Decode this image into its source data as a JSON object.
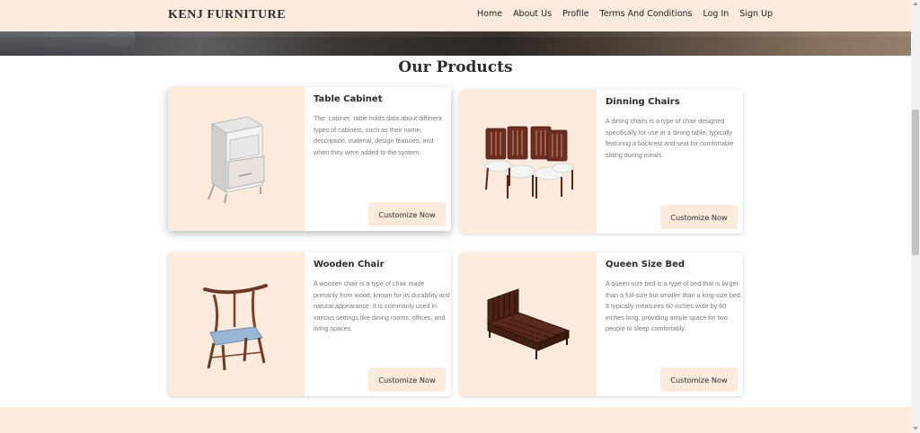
{
  "brand": "KENJ FURNITURE",
  "nav": [
    {
      "label": "Home"
    },
    {
      "label": "About Us"
    },
    {
      "label": "Profile"
    },
    {
      "label": "Terms And Conditions"
    },
    {
      "label": "Log In"
    },
    {
      "label": "Sign Up"
    }
  ],
  "section_title": "Our Products",
  "products": [
    {
      "title": "Table Cabinet",
      "description": "The `cabinet` table holds data about different types of cabinets, such as their name, description, material, design features, and when they were added to the system.",
      "button": "Customize Now",
      "image_icon": "cabinet-icon"
    },
    {
      "title": "Dinning Chairs",
      "description": "A dining chairs is a type of chair designed specifically for use at a dining table, typically featuring a backrest and seat for comfortable sitting during meals.",
      "button": "Customize Now",
      "image_icon": "dining-chairs-icon"
    },
    {
      "title": "Wooden Chair",
      "description": "A wooden chair is a type of chair made primarily from wood, known for its durability and natural appearance. It is commonly used in various settings like dining rooms, offices, and living spaces.",
      "button": "Customize Now",
      "image_icon": "wooden-chair-icon"
    },
    {
      "title": "Queen Size Bed",
      "description": "A queen-size bed is a type of bed that is larger than a full-size but smaller than a king-size bed. It typically measures 60 inches wide by 80 inches long, providing ample space for two people to sleep comfortably.",
      "button": "Customize Now",
      "image_icon": "bed-icon"
    }
  ],
  "colors": {
    "accent": "#fcebdc",
    "text_dark": "#2b2b2b",
    "text_muted": "#7a7a7a"
  }
}
